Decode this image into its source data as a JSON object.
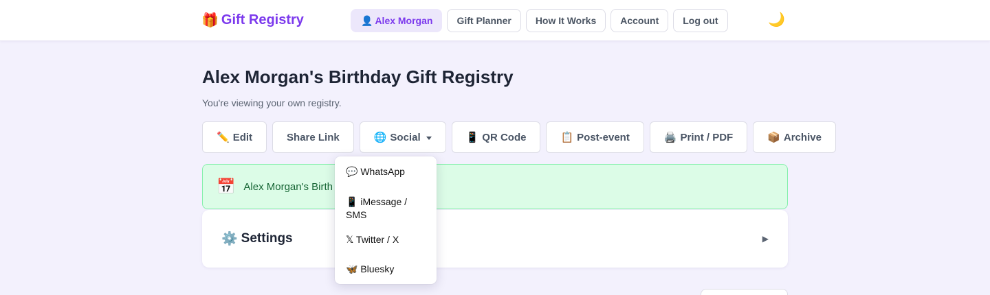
{
  "header": {
    "brand_icon": "🎁",
    "brand": "Gift Registry",
    "nav": [
      {
        "icon": "👤",
        "label": "Alex Morgan",
        "active": true
      },
      {
        "label": "Gift Planner"
      },
      {
        "label": "How It Works"
      },
      {
        "label": "Account"
      },
      {
        "label": "Log out"
      }
    ],
    "theme_icon": "🌙"
  },
  "page": {
    "title": "Alex Morgan's Birthday Gift Registry",
    "subtitle": "You're viewing your own registry."
  },
  "actions": [
    {
      "icon": "✏️",
      "label": "Edit"
    },
    {
      "label": "Share Link"
    },
    {
      "icon": "🌐",
      "label": "Social",
      "has_caret": true
    },
    {
      "icon": "📱",
      "label": "QR Code"
    },
    {
      "icon": "📋",
      "label": "Post-event"
    },
    {
      "icon": "🖨️",
      "label": "Print / PDF"
    },
    {
      "icon": "📦",
      "label": "Archive"
    }
  ],
  "banner": {
    "icon": "📅",
    "text": "Alex Morgan's Birth"
  },
  "settings": {
    "icon": "⚙️",
    "title": "Settings",
    "arrow": "▶"
  },
  "social_menu": [
    {
      "icon": "💬",
      "label": "WhatsApp"
    },
    {
      "icon": "📱",
      "label": "iMessage / SMS"
    },
    {
      "icon": "𝕏",
      "label": "Twitter / X"
    },
    {
      "icon": "🦋",
      "label": "Bluesky"
    }
  ],
  "colors": {
    "accent": "#7c3aed",
    "background": "#f3f1fd",
    "banner_bg": "#dcfce7",
    "banner_text": "#166534"
  }
}
